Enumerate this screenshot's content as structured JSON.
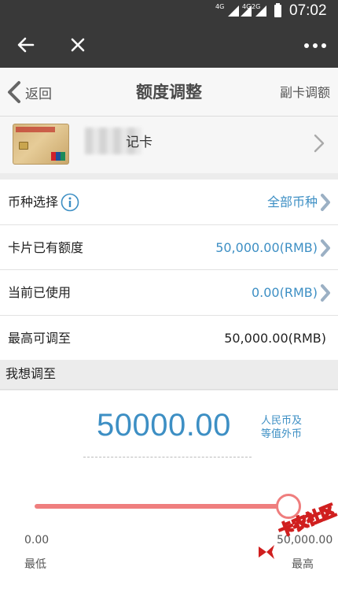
{
  "status_bar": {
    "net1": "4G",
    "net2": "4G",
    "net3": "2G",
    "time": "07:02"
  },
  "topbar": {
    "back_icon": "arrow-left-icon",
    "close_icon": "close-icon",
    "more_icon": "more-icon"
  },
  "nav": {
    "back_label": "返回",
    "title": "额度调整",
    "right_link": "副卡调额"
  },
  "card": {
    "name_suffix": "记卡"
  },
  "rows": [
    {
      "label": "币种选择",
      "value": "全部币种"
    },
    {
      "label": "卡片已有额度",
      "value": "50,000.00(RMB)"
    },
    {
      "label": "当前已使用",
      "value": "0.00(RMB)"
    },
    {
      "label": "最高可调至",
      "value": "50,000.00(RMB)"
    }
  ],
  "section_title": "我想调至",
  "amount": {
    "value": "50000.00",
    "currency_line1": "人民币及",
    "currency_line2": "等值外币"
  },
  "slider": {
    "level": 1.0,
    "min_value": "0.00",
    "min_label": "最低",
    "max_value": "50,000.00",
    "max_label": "最高"
  },
  "watermark": {
    "text": "卡农社区"
  },
  "colors": {
    "accent_blue": "#3d8fc4",
    "slider_red": "#ef7e7e",
    "dark_bar": "#393939"
  }
}
